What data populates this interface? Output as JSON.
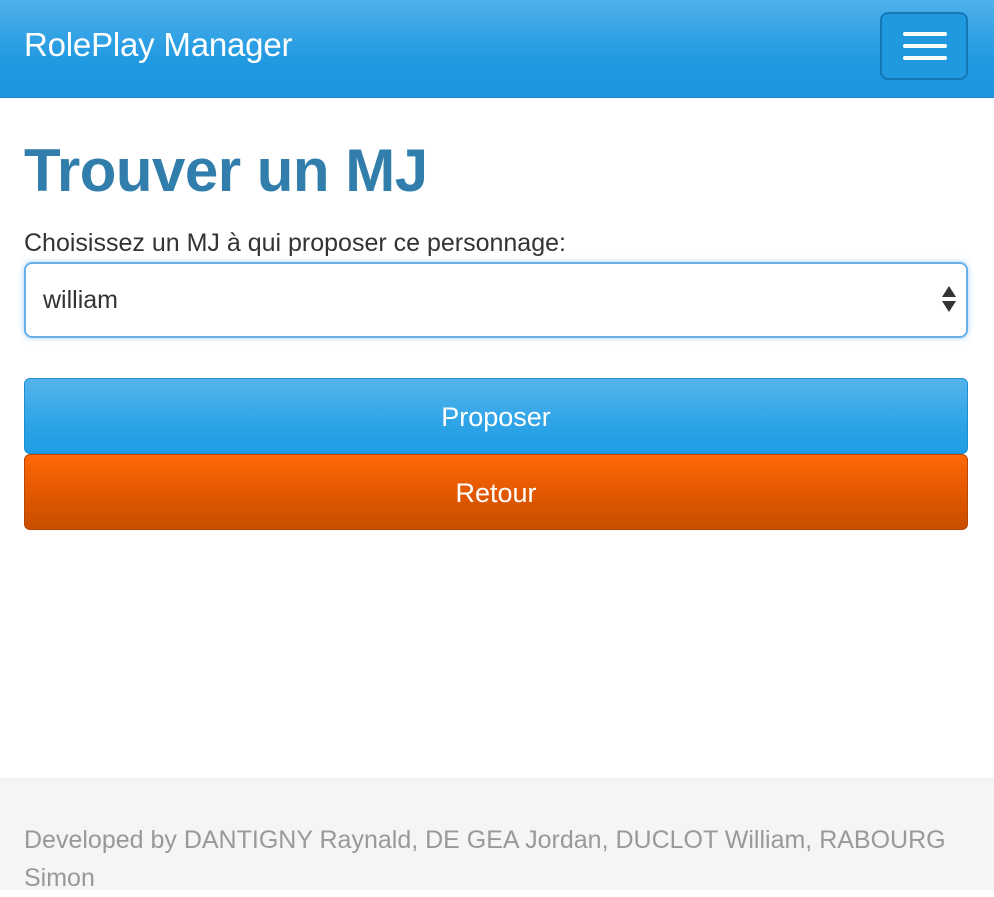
{
  "navbar": {
    "brand": "RolePlay Manager",
    "toggle_icon": "hamburger-menu-icon"
  },
  "main": {
    "title": "Trouver un MJ",
    "select_label": "Choisissez un MJ à qui proposer ce personnage:",
    "select_value": "william",
    "propose_label": "Proposer",
    "back_label": "Retour"
  },
  "footer": {
    "text": "Developed by DANTIGNY Raynald, DE GEA Jordan, DUCLOT William, RABOURG Simon"
  },
  "colors": {
    "navbar": "#2fa4e7",
    "title": "#317eac",
    "primary_button": "#2fa4e7",
    "warning_button": "#dd5600",
    "footer_background": "#f5f5f5",
    "footer_text": "#999999"
  }
}
